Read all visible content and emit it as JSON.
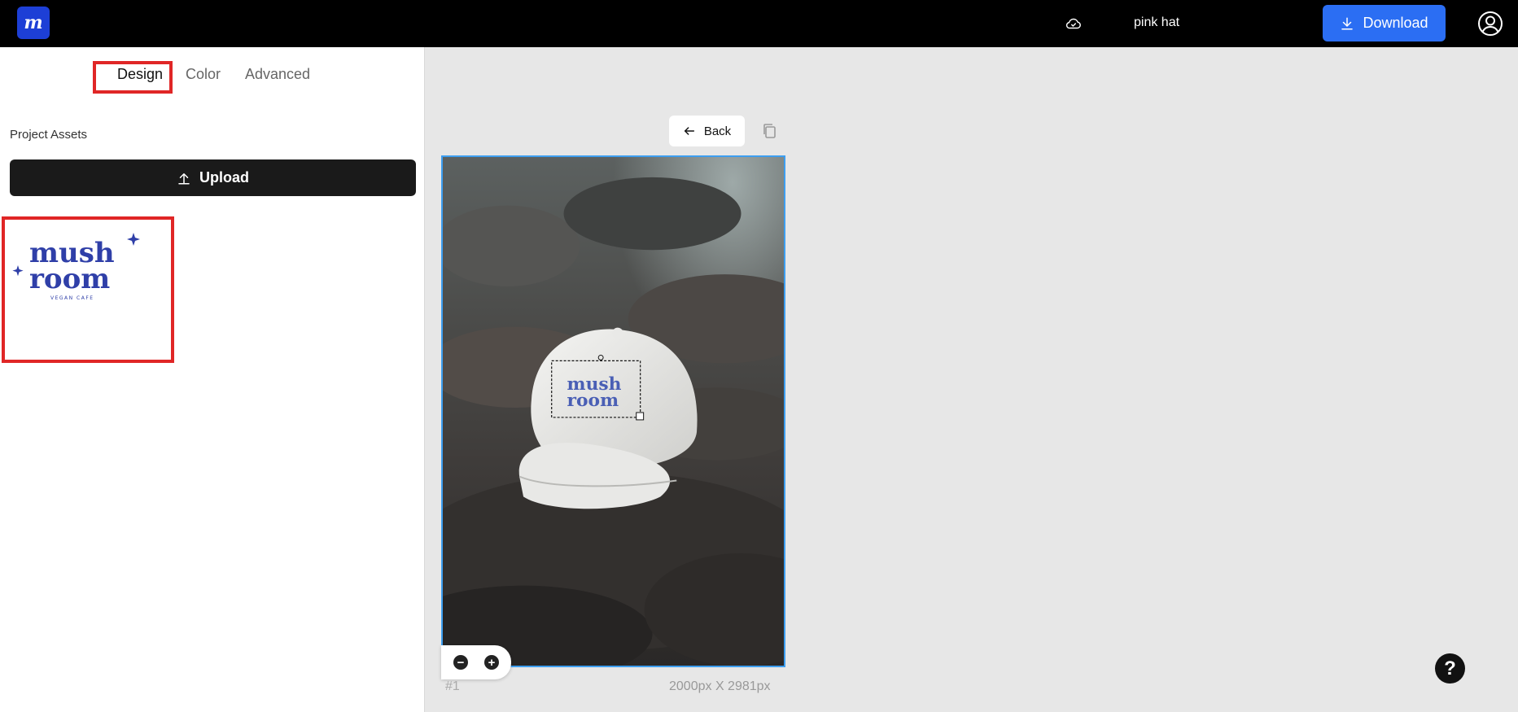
{
  "header": {
    "logo_letter": "m",
    "project_name": "pink hat",
    "download_label": "Download",
    "icons": [
      "cloud-icon",
      "download-icon",
      "account-icon"
    ]
  },
  "sidebar": {
    "tabs": [
      {
        "label": "Design",
        "active": true
      },
      {
        "label": "Color",
        "active": false
      },
      {
        "label": "Advanced",
        "active": false
      }
    ],
    "assets_label": "Project Assets",
    "upload_label": "Upload",
    "asset": {
      "line1": "mush",
      "line2": "room",
      "tagline": "VEGAN CAFE"
    }
  },
  "canvas": {
    "back_label": "Back",
    "page_index": "#1",
    "dimensions": "2000px X 2981px",
    "zoom_out": "−",
    "zoom_in": "+",
    "help": "?"
  },
  "colors": {
    "topbar": "#000000",
    "accent": "#2b6ef3",
    "selection": "#3d9ef0",
    "highlight": "#e02626",
    "logo_blue": "#2f3fa8"
  }
}
